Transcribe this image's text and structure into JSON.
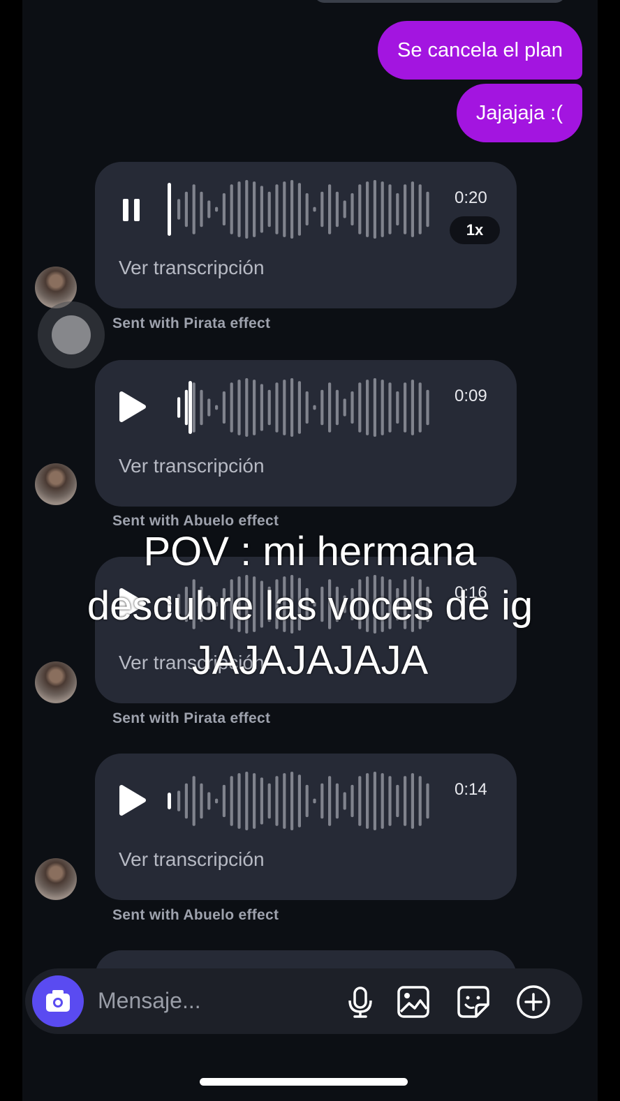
{
  "messages_out": [
    {
      "text": "Se cancela el plan"
    },
    {
      "text": "Jajajaja :("
    }
  ],
  "voice_messages": [
    {
      "duration": "0:20",
      "speed": "1x",
      "state": "playing",
      "transcription_link": "Ver transcripción",
      "effect": "Sent with Pirata effect"
    },
    {
      "duration": "0:09",
      "state": "paused",
      "transcription_link": "Ver transcripción",
      "effect": "Sent with Abuelo effect"
    },
    {
      "duration": "0:16",
      "state": "paused",
      "transcription_link": "Ver transcripción",
      "effect": "Sent with Pirata effect"
    },
    {
      "duration": "0:14",
      "state": "paused",
      "transcription_link": "Ver transcripción",
      "effect": "Sent with Abuelo effect"
    }
  ],
  "overlay": {
    "line1": "POV : mi hermana",
    "line2": "descubre las voces de ig",
    "line3": "JAJAJAJAJA"
  },
  "composer": {
    "placeholder": "Mensaje...",
    "icons": [
      "camera-icon",
      "microphone-icon",
      "gallery-icon",
      "sticker-icon",
      "plus-icon"
    ]
  },
  "colors": {
    "outgoing_bubble": "#a315e0",
    "card_bg": "#262a36",
    "camera_button": "#5a4bf1",
    "background": "#0c0f14"
  }
}
